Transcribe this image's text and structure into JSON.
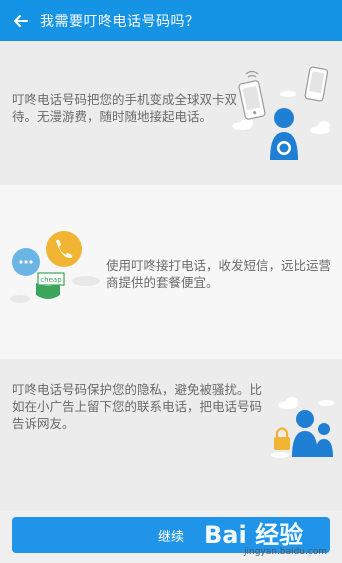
{
  "header": {
    "title": "我需要叮咚电话号码吗？"
  },
  "sections": [
    {
      "text": "叮咚电话号码把您的手机变成全球双卡双待。无漫游费，随时随地接起电话。"
    },
    {
      "text": "使用叮咚接打电话，收发短信，远比运营商提供的套餐便宜。",
      "illus_label": "cheap"
    },
    {
      "text": "叮咚电话号码保护您的隐私，避免被骚扰。比如在小广告上留下您的联系电话，把电话号码告诉网友。"
    }
  ],
  "footer": {
    "continue_label": "继续"
  },
  "watermark": {
    "logo": "Bai 经验",
    "sub": "jingyan.baidu.com"
  },
  "colors": {
    "primary": "#1594e6",
    "yellow": "#f2b533",
    "green": "#3ca55c",
    "blue_bubble": "#6bb4e6"
  }
}
